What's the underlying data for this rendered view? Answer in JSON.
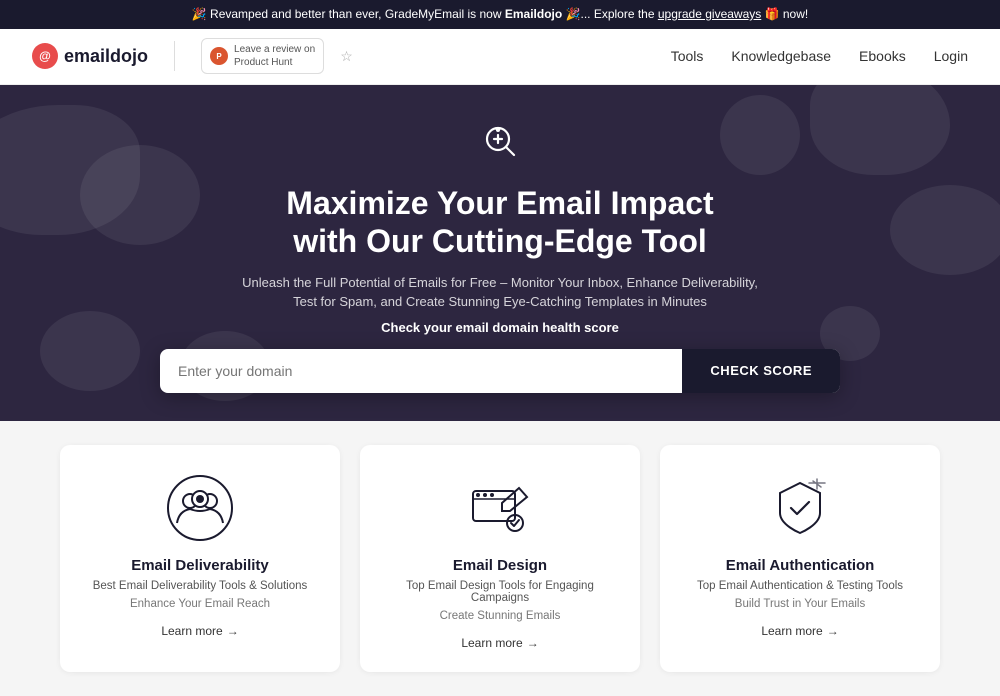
{
  "banner": {
    "text_before": "🎉 Revamped and better than ever, GradeMyEmail is now ",
    "brand_name": "Emaildojo",
    "text_after": " 🎉... Explore the ",
    "link_text": "upgrade giveaways",
    "text_end": " 🎁 now!"
  },
  "header": {
    "logo_text": "emaildojo",
    "product_hunt_label": "Leave a review on\nProduct Hunt",
    "nav": {
      "tools": "Tools",
      "knowledgebase": "Knowledgebase",
      "ebooks": "Ebooks",
      "login": "Login"
    }
  },
  "hero": {
    "title_line1": "Maximize Your Email Impact",
    "title_line2": "with Our Cutting-Edge Tool",
    "subtitle": "Unleash the Full Potential of Emails for Free – Monitor Your Inbox, Enhance Deliverability, Test for Spam, and Create Stunning Eye-Catching Templates in Minutes",
    "cta_text": "Check your email domain health score",
    "input_placeholder": "Enter your domain",
    "check_score_label": "CHECK SCORE"
  },
  "cards": [
    {
      "title": "Email Deliverability",
      "desc": "Best Email Deliverability Tools & Solutions",
      "subdesc": "Enhance Your Email Reach",
      "learn_more": "Learn more"
    },
    {
      "title": "Email Design",
      "desc": "Top Email Design Tools for Engaging Campaigns",
      "subdesc": "Create Stunning Emails",
      "learn_more": "Learn more"
    },
    {
      "title": "Email Authentication",
      "desc": "Top Email Authentication & Testing Tools",
      "subdesc": "Build Trust in Your Emails",
      "learn_more": "Learn more"
    }
  ]
}
